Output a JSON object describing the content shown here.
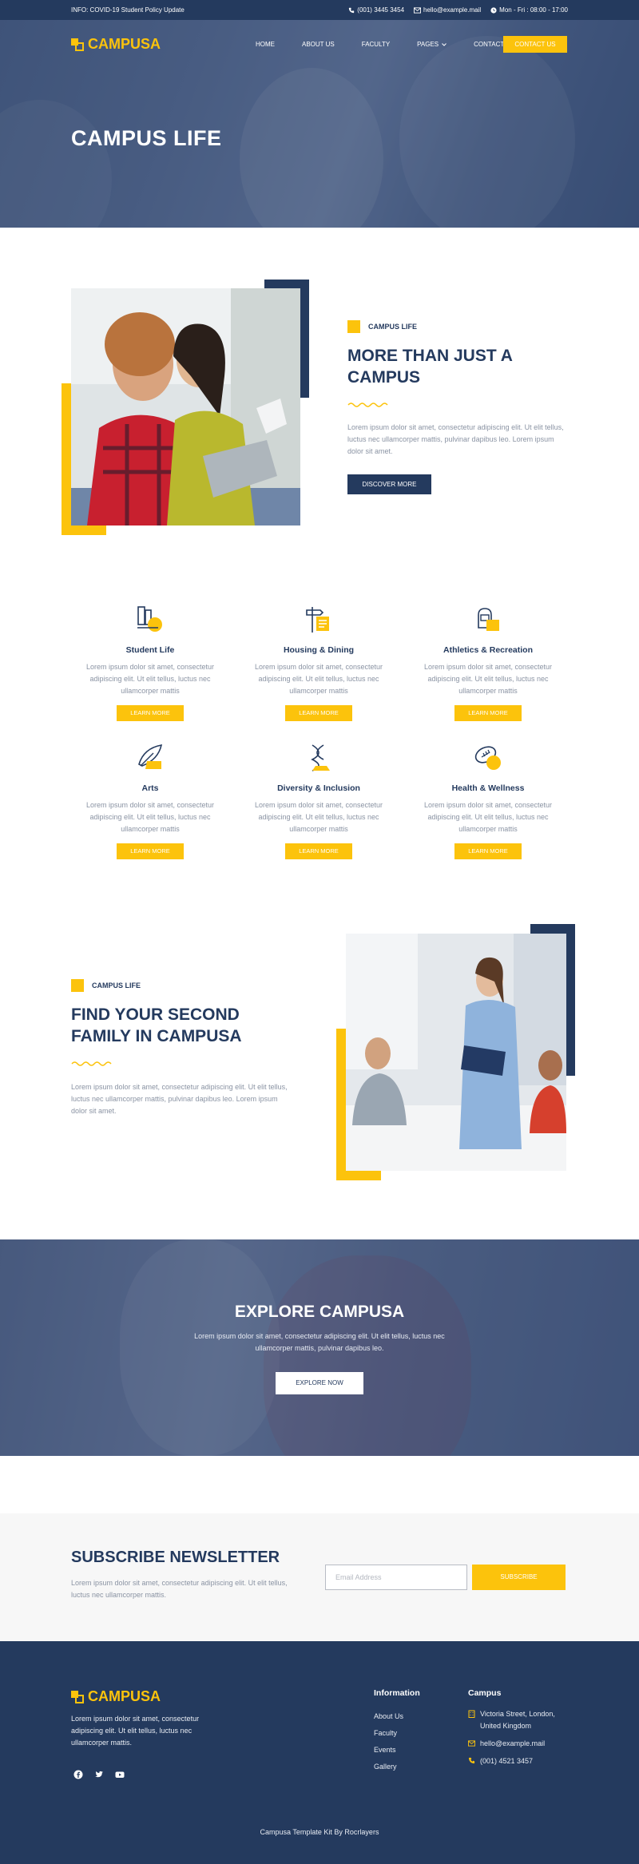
{
  "topbar": {
    "info": "INFO: COVID-19 Student Policy Update",
    "phone": "(001) 3445 3454",
    "email": "hello@example.mail",
    "hours": "Mon - Fri : 08:00 - 17:00"
  },
  "brand": {
    "name": "CAMPUSA",
    "accent": "#fcc30c",
    "navy": "#243a5e"
  },
  "nav": {
    "items": [
      "HOME",
      "ABOUT US",
      "FACULTY",
      "PAGES",
      "CONTACT US"
    ],
    "cta": "CONTACT US"
  },
  "hero": {
    "title": "CAMPUS LIFE"
  },
  "about": {
    "eyebrow": "CAMPUS LIFE",
    "title_line1": "MORE THAN JUST A",
    "title_line2": "CAMPUS",
    "text": "Lorem ipsum dolor sit amet, consectetur adipiscing elit. Ut elit tellus, luctus nec ullamcorper mattis, pulvinar dapibus leo. Lorem ipsum dolor sit amet.",
    "button": "DISCOVER MORE"
  },
  "features": [
    {
      "title": "Student Life",
      "icon": "student-life-icon",
      "text": "Lorem ipsum dolor sit amet, consectetur adipiscing elit. Ut elit tellus, luctus nec ullamcorper mattis",
      "button": "LEARN MORE"
    },
    {
      "title": "Housing & Dining",
      "icon": "housing-icon",
      "text": "Lorem ipsum dolor sit amet, consectetur adipiscing elit. Ut elit tellus, luctus nec ullamcorper mattis",
      "button": "LEARN MORE"
    },
    {
      "title": "Athletics & Recreation",
      "icon": "athletics-icon",
      "text": "Lorem ipsum dolor sit amet, consectetur adipiscing elit. Ut elit tellus, luctus nec ullamcorper mattis",
      "button": "LEARN MORE"
    },
    {
      "title": "Arts",
      "icon": "arts-icon",
      "text": "Lorem ipsum dolor sit amet, consectetur adipiscing elit. Ut elit tellus, luctus nec ullamcorper mattis",
      "button": "LEARN MORE"
    },
    {
      "title": "Diversity & Inclusion",
      "icon": "dna-icon",
      "text": "Lorem ipsum dolor sit amet, consectetur adipiscing elit. Ut elit tellus, luctus nec ullamcorper mattis",
      "button": "LEARN MORE"
    },
    {
      "title": "Health & Wellness",
      "icon": "football-icon",
      "text": "Lorem ipsum dolor sit amet, consectetur adipiscing elit. Ut elit tellus, luctus nec ullamcorper mattis",
      "button": "LEARN MORE"
    }
  ],
  "family": {
    "eyebrow": "CAMPUS LIFE",
    "title_line1": "FIND YOUR SECOND",
    "title_line2": "FAMILY IN CAMPUSA",
    "text": "Lorem ipsum dolor sit amet, consectetur adipiscing elit. Ut elit tellus, luctus nec ullamcorper mattis, pulvinar dapibus leo. Lorem ipsum dolor sit amet."
  },
  "explore": {
    "title": "EXPLORE CAMPUSA",
    "text": "Lorem ipsum dolor sit amet, consectetur adipiscing elit. Ut elit tellus, luctus nec ullamcorper mattis, pulvinar dapibus leo.",
    "button": "EXPLORE NOW"
  },
  "newsletter": {
    "title": "SUBSCRIBE NEWSLETTER",
    "text": "Lorem ipsum dolor sit amet, consectetur adipiscing elit. Ut elit tellus, luctus nec ullamcorper mattis.",
    "placeholder": "Email Address",
    "button": "SUBSCRIBE"
  },
  "footer": {
    "description": "Lorem ipsum dolor sit amet, consectetur adipiscing elit. Ut elit tellus, luctus nec ullamcorper mattis.",
    "info_heading": "Information",
    "info_links": [
      "About Us",
      "Faculty",
      "Events",
      "Gallery"
    ],
    "campus_heading": "Campus",
    "address": "Victoria Street, London, United Kingdom",
    "email": "hello@example.mail",
    "phone": "(001) 4521 3457",
    "credit": "Campusa Template Kit By Rocrlayers"
  }
}
